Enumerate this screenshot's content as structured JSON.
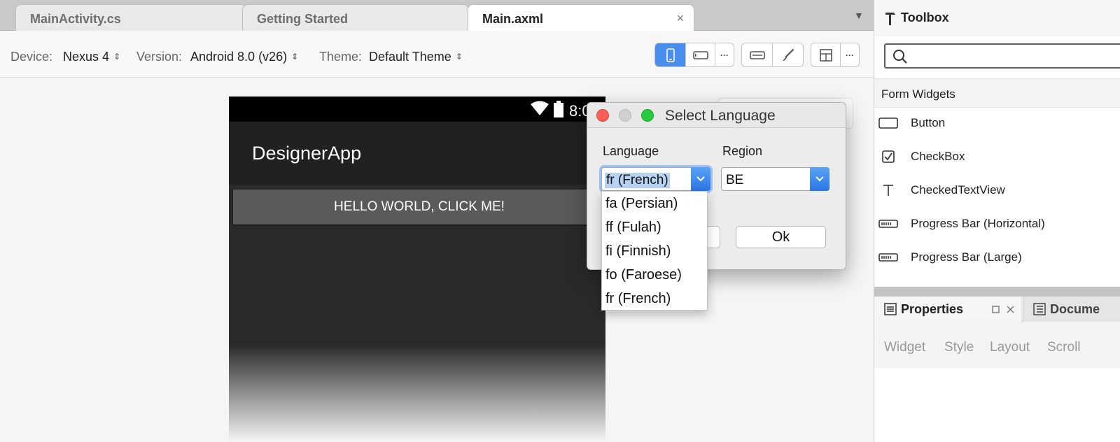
{
  "tabs": [
    {
      "label": "MainActivity.cs"
    },
    {
      "label": "Getting Started"
    },
    {
      "label": "Main.axml",
      "close": "×"
    }
  ],
  "tab_menu_icon": "triangle-down-icon",
  "toolbar": {
    "device_label": "Device:",
    "device_value": "Nexus 4",
    "version_label": "Version:",
    "version_value": "Android 8.0 (v26)",
    "theme_label": "Theme:",
    "theme_value": "Default Theme",
    "updown_glyph": "⌃⌄",
    "more": "···"
  },
  "phone": {
    "time": "8:0",
    "app_title": "DesignerApp",
    "button_text": "HELLO WORLD, CLICK ME!"
  },
  "dialog": {
    "title": "Select Language",
    "language_label": "Language",
    "region_label": "Region",
    "language_value": "fr (French)",
    "region_value": "BE",
    "ok_label": "Ok",
    "options": [
      "fa (Persian)",
      "ff (Fulah)",
      "fi (Finnish)",
      "fo (Faroese)",
      "fr (French)"
    ]
  },
  "toolbox": {
    "title": "Toolbox",
    "search_placeholder": "",
    "section": "Form Widgets",
    "items": [
      {
        "label": "Button",
        "icon": "button-icon"
      },
      {
        "label": "CheckBox",
        "icon": "checkbox-icon"
      },
      {
        "label": "CheckedTextView",
        "icon": "text-icon"
      },
      {
        "label": "Progress Bar (Horizontal)",
        "icon": "progress-bar-icon"
      },
      {
        "label": "Progress Bar (Large)",
        "icon": "progress-bar-icon"
      }
    ]
  },
  "properties": {
    "title": "Properties",
    "docs_title": "Docume",
    "tabs": [
      "Widget",
      "Style",
      "Layout",
      "Scroll"
    ]
  },
  "colors": {
    "accent": "#4a8eed",
    "close_red": "#fd5f57",
    "minimize_gray": "#d0d0d0",
    "zoom_green": "#29c940"
  }
}
